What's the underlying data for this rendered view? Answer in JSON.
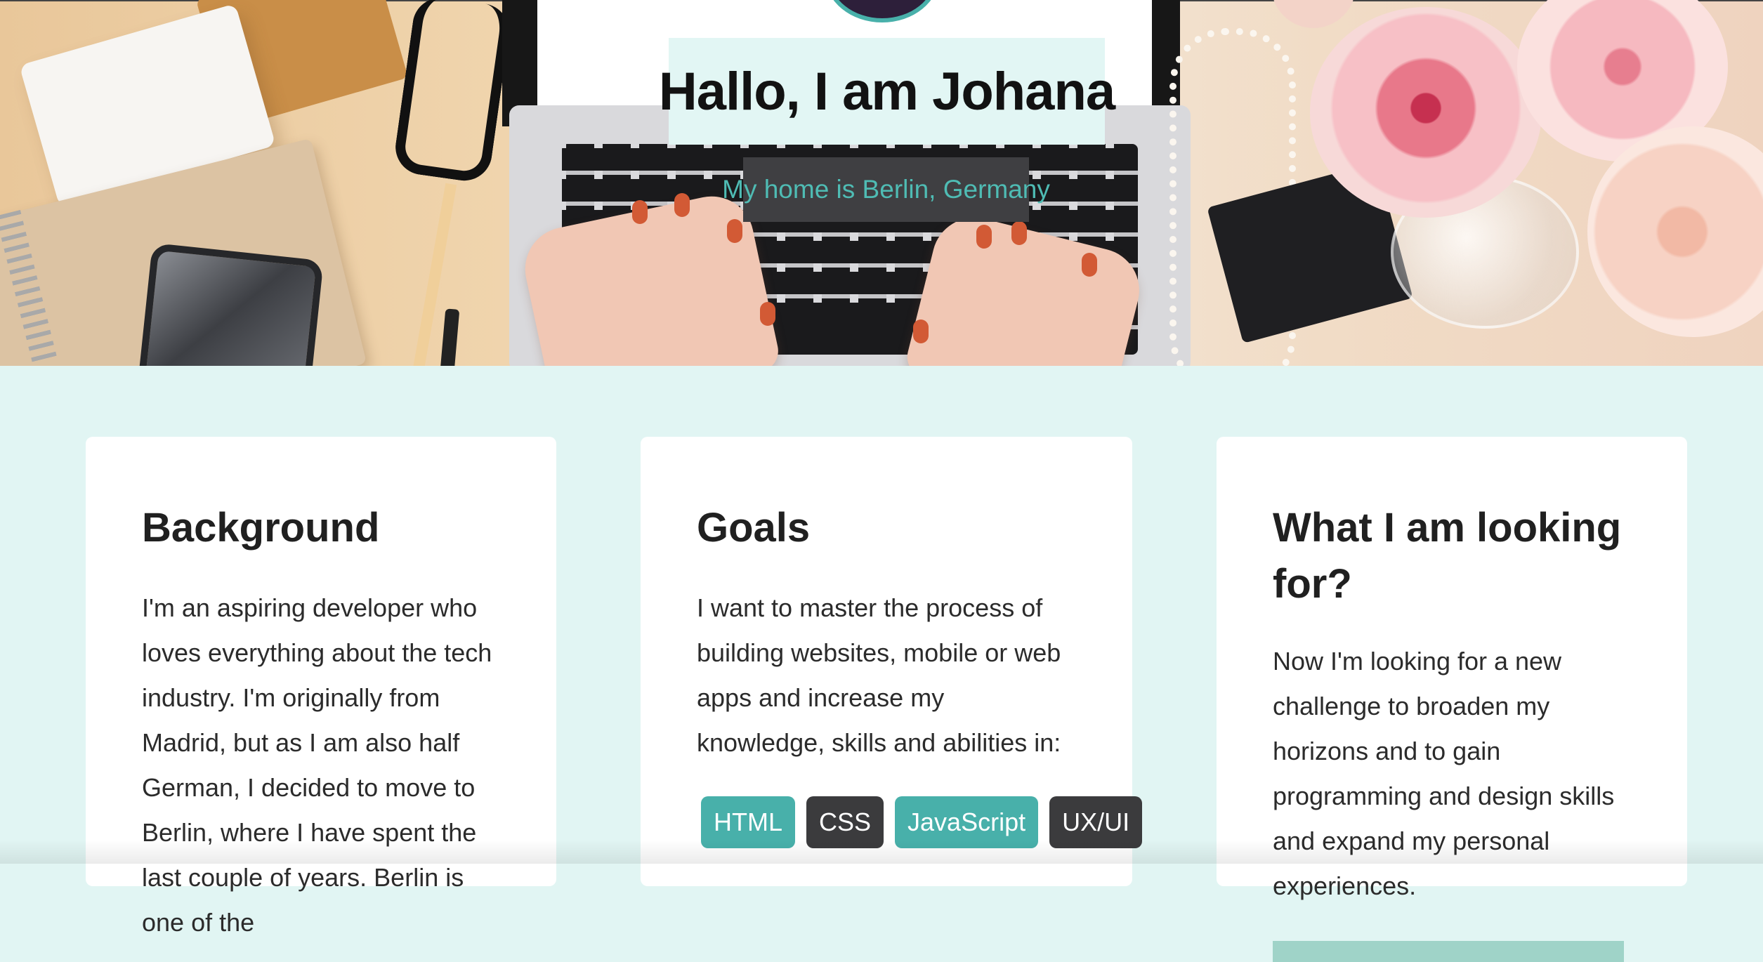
{
  "hero": {
    "title": "Hallo, I am Johana",
    "subtitle": "My home is Berlin, Germany",
    "image_icon": "desk-laptop-roses-photo",
    "colors": {
      "title_bg": "#e2f6f4",
      "subtitle_bg": "#3f3f42",
      "subtitle_text": "#4fbcb4",
      "page_bg": "#e1f5f3"
    }
  },
  "cards": {
    "background": {
      "heading": "Background",
      "text": "I'm an aspiring developer who loves everything about the tech industry. I'm originally from Madrid, but as I am also half German, I decided to move to Berlin, where I have spent the last couple of years. Berlin is one of the"
    },
    "goals": {
      "heading": "Goals",
      "text": "I want to master the process of building websites, mobile or web apps and increase my knowledge, skills and abilities in:",
      "tags": [
        "HTML",
        "CSS",
        "JavaScript",
        "UX/UI"
      ],
      "tag_colors": [
        "#48b0aa",
        "#3b3b3d",
        "#48b0aa",
        "#3b3b3d"
      ]
    },
    "looking_for": {
      "heading": "What I am looking for?",
      "text": "Now I'm looking for a new challenge to broaden my horizons and to gain programming and design skills and expand my personal experiences."
    }
  }
}
